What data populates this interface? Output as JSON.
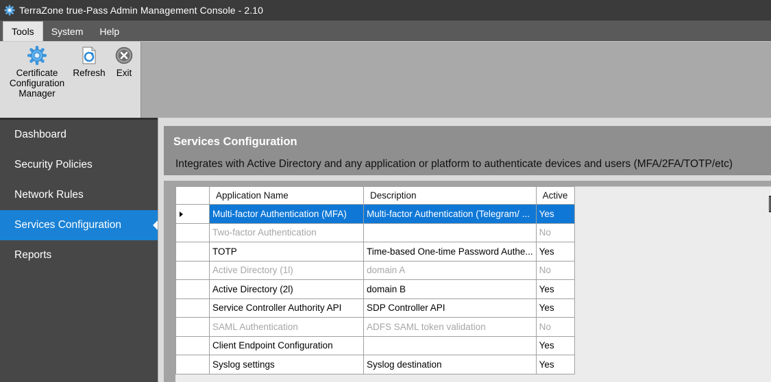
{
  "window": {
    "title": "TerraZone true-Pass Admin Management Console  - 2.10",
    "icon": "gear-icon"
  },
  "menu": {
    "items": [
      {
        "label": "Tools",
        "active": true
      },
      {
        "label": "System",
        "active": false
      },
      {
        "label": "Help",
        "active": false
      }
    ]
  },
  "ribbon": {
    "cert_label": "Certificate Configuration Manager",
    "cert_icon": "gear-icon",
    "refresh_label": "Refresh",
    "refresh_icon": "refresh-icon",
    "exit_label": "Exit",
    "exit_icon": "close-circle-icon"
  },
  "sidebar": {
    "items": [
      {
        "label": "Dashboard"
      },
      {
        "label": "Security Policies"
      },
      {
        "label": "Network Rules"
      },
      {
        "label": "Services Configuration",
        "selected": true
      },
      {
        "label": "Reports"
      }
    ]
  },
  "header": {
    "title": "Services Configuration",
    "description": "Integrates with Active Directory and any application or platform to authenticate devices and users (MFA/2FA/TOTP/etc)"
  },
  "grid": {
    "columns": [
      "Application Name",
      "Description",
      "Active"
    ],
    "rows": [
      {
        "name": "Multi-factor Authentication (MFA)",
        "description": "Multi-factor Authentication (Telegram/ ...",
        "active": "Yes",
        "selected": true,
        "disabled": false
      },
      {
        "name": "Two-factor Authentication",
        "description": "",
        "active": "No",
        "selected": false,
        "disabled": true
      },
      {
        "name": "TOTP",
        "description": "Time-based One-time Password Authe...",
        "active": "Yes",
        "selected": false,
        "disabled": false
      },
      {
        "name": "Active Directory (1l)",
        "description": "domain A",
        "active": "No",
        "selected": false,
        "disabled": true
      },
      {
        "name": "Active Directory (2l)",
        "description": "domain B",
        "active": "Yes",
        "selected": false,
        "disabled": false
      },
      {
        "name": "Service Controller Authority API",
        "description": "SDP Controller API",
        "active": "Yes",
        "selected": false,
        "disabled": false
      },
      {
        "name": "SAML Authentication",
        "description": "ADFS SAML token validation",
        "active": "No",
        "selected": false,
        "disabled": true
      },
      {
        "name": "Client Endpoint Configuration",
        "description": "",
        "active": "Yes",
        "selected": false,
        "disabled": false
      },
      {
        "name": "Syslog settings",
        "description": "Syslog destination",
        "active": "Yes",
        "selected": false,
        "disabled": false
      }
    ]
  },
  "colors": {
    "selection": "#0f78d7",
    "nav_selected": "#1a82d6",
    "sidebar": "#474747",
    "disabled_text": "#a6a6a6"
  }
}
